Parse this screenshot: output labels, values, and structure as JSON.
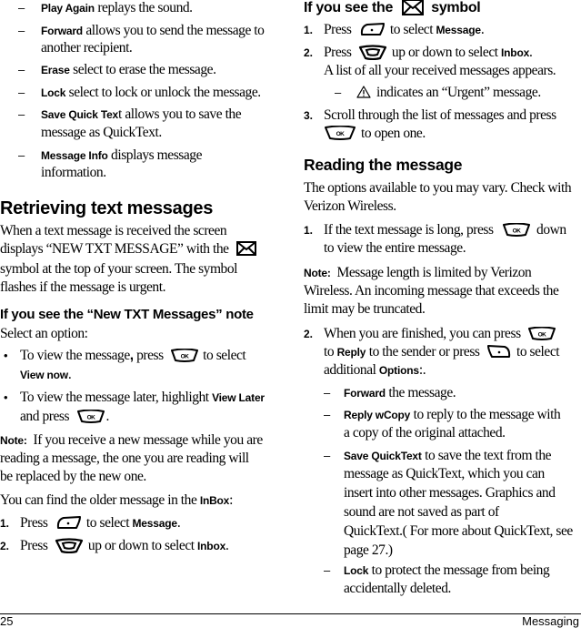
{
  "left_column": {
    "option_list": [
      {
        "term": "Play Again",
        "lines": [
          " replays the sound."
        ]
      },
      {
        "term": "Forward",
        "lines": [
          " allows you to send the message to",
          "another recipient."
        ]
      },
      {
        "term": "Erase",
        "lines": [
          " select to erase the message."
        ]
      },
      {
        "term": "Lock",
        "lines": [
          " select to lock or unlock the message."
        ]
      },
      {
        "term": "Save Quick Tex",
        "lines": [
          "t allows you to save the",
          "message as QuickText."
        ]
      },
      {
        "term": "Message Info",
        "lines": [
          " displays message",
          "information."
        ]
      }
    ],
    "retrieving": {
      "heading": "Retrieving text messages",
      "para_lines": [
        "When a text message is received the screen",
        "displays “NEW TXT MESSAGE” with the",
        "symbol at the top of your screen. The symbol",
        "flashes if the message is urgent."
      ]
    },
    "new_txt_note": {
      "heading": "If you see the “New TXT Messages” note",
      "intro": "Select an option:",
      "bullet1_a": "To view the message",
      "bullet1_comma": ",",
      "bullet1_b": " press",
      "bullet1_c": "to select",
      "bullet1_term": "View now",
      "bullet1_end": ".",
      "bullet2_a": "To view the message later, highlight ",
      "bullet2_term": "View Later",
      "bullet2_b": "and press",
      "bullet2_end": "."
    },
    "note": {
      "label": "Note:",
      "lines": [
        "If you receive a new message while you are",
        "reading a message, the one you are reading will",
        "be replaced by the new one."
      ]
    },
    "inbox_intro": "You can find the older message in the ",
    "inbox_term": "InBox",
    "inbox_end": ":",
    "steps": [
      {
        "num": "1.",
        "a": "Press",
        "b": "to select ",
        "term": "Message",
        "end": "."
      },
      {
        "num": "2.",
        "a": "Press",
        "b": "up or down to select ",
        "term": "Inbox",
        "end": "."
      }
    ]
  },
  "right_column": {
    "symbol_section": {
      "heading_a": "If you see the",
      "heading_b": "symbol",
      "steps": [
        {
          "num": "1.",
          "a": "Press",
          "b": "to select ",
          "term": "Message",
          "end": "."
        },
        {
          "num": "2.",
          "a": "Press",
          "b": "up or down to select ",
          "term": "Inbox",
          "end": ".",
          "extra": "A list of all your received messages appears."
        },
        {
          "num": "3.",
          "a": "Scroll through the list of messages and press",
          "b": "to open one."
        }
      ],
      "urgent_note": "indicates an “Urgent” message."
    },
    "reading": {
      "heading": "Reading the message",
      "para_lines": [
        "The options available to you may vary. Check with",
        "Verizon Wireless."
      ],
      "step1_num": "1.",
      "step1_a": "If the text message is long, press",
      "step1_b": "down",
      "step1_c": "to view the entire message.",
      "note_label": "Note:",
      "note_lines": [
        "Message length is limited by Verizon",
        "Wireless. An incoming message that exceeds the",
        "limit may be truncated."
      ],
      "step2_num": "2.",
      "step2_a": "When you are finished, you can press",
      "step2_b": "to ",
      "step2_reply": "Reply",
      "step2_c": " to the sender or press",
      "step2_d": "to select",
      "step2_e": "additional ",
      "step2_options": "Options",
      "step2_end": ":.",
      "sub_options": [
        {
          "term": "Forward",
          "lines": [
            " the message."
          ]
        },
        {
          "term": "Reply wCopy",
          "lines": [
            " to reply to the message with",
            "a copy of the original attached."
          ]
        },
        {
          "term": "Save QuickText",
          "lines": [
            " to save the text from the",
            "message as QuickText, which you can",
            "insert into other messages. Graphics and",
            "sound are not saved as part of",
            "QuickText.( For more about QuickText, see",
            "page 27.)"
          ]
        },
        {
          "term": "Lock",
          "lines": [
            " to protect the message from being",
            "accidentally deleted."
          ]
        }
      ]
    }
  },
  "footer": {
    "page_number": "25",
    "section": "Messaging"
  },
  "glyphs": {
    "dash": "–",
    "bullet": "•"
  }
}
